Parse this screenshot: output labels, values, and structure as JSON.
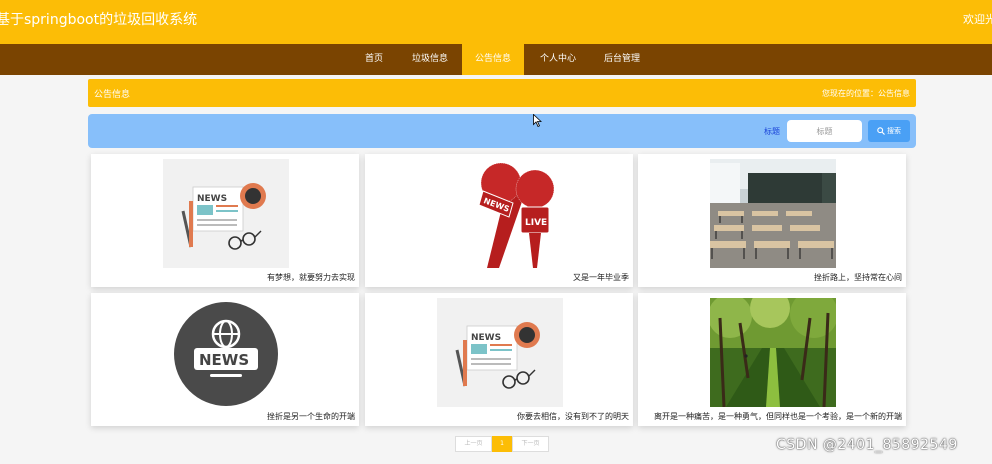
{
  "header": {
    "site_title": "基于springboot的垃圾回收系统",
    "welcome": "欢迎光"
  },
  "nav": {
    "items": [
      {
        "label": "首页"
      },
      {
        "label": "垃圾信息"
      },
      {
        "label": "公告信息"
      },
      {
        "label": "个人中心"
      },
      {
        "label": "后台管理"
      }
    ],
    "active_index": 2
  },
  "section": {
    "title": "公告信息",
    "breadcrumb": "您现在的位置：公告信息"
  },
  "search": {
    "label": "标题",
    "placeholder": "标题",
    "button_label": "搜索",
    "button_icon": "search-icon"
  },
  "cards": [
    {
      "caption": "有梦想，就要努力去实现",
      "image": "news-paper-illustration"
    },
    {
      "caption": "又是一年毕业季",
      "image": "live-news-microphones"
    },
    {
      "caption": "挫折路上，坚持常在心间",
      "image": "classroom-photo"
    },
    {
      "caption": "挫折是另一个生命的开端",
      "image": "news-globe-badge"
    },
    {
      "caption": "你要去相信，没有到不了的明天",
      "image": "news-paper-illustration"
    },
    {
      "caption": "离开是一种痛苦，是一种勇气，但同样也是一个考验，是一个新的开端",
      "image": "tree-lined-path-photo"
    }
  ],
  "pagination": {
    "prev_label": "上一页",
    "current_page": "1",
    "next_label": "下一页"
  },
  "watermark": "CSDN @2401_85892549",
  "colors": {
    "topbar": "#fcbd06",
    "navbar": "#7a4401",
    "search_bar": "#87bffa",
    "search_button": "#4aa0f5",
    "page_background": "#f5f5f5"
  }
}
